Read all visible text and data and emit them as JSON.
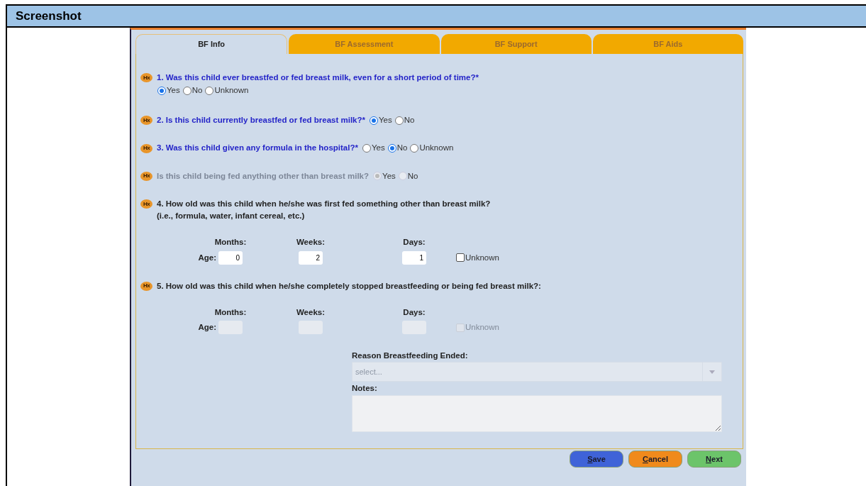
{
  "document_header": {
    "title": "Screenshot"
  },
  "tabs": [
    {
      "label": "BF Info",
      "selected": true
    },
    {
      "label": "BF Assessment",
      "selected": false
    },
    {
      "label": "BF Support",
      "selected": false
    },
    {
      "label": "BF Aids",
      "selected": false
    }
  ],
  "questions": [
    {
      "kind": "radio-below",
      "badge": "Hx",
      "text": "1. Was this child ever breastfed or fed breast milk, even for a short period of time?*",
      "required": true,
      "disabled": false,
      "options": [
        {
          "label": "Yes",
          "selected": true
        },
        {
          "label": "No",
          "selected": false
        },
        {
          "label": "Unknown",
          "selected": false
        }
      ]
    },
    {
      "kind": "radio-inline",
      "badge": "Hx",
      "text": "2. Is this child currently breastfed or fed breast milk?*",
      "required": true,
      "disabled": false,
      "options": [
        {
          "label": "Yes",
          "selected": true
        },
        {
          "label": "No",
          "selected": false
        }
      ]
    },
    {
      "kind": "radio-inline",
      "badge": "Hx",
      "text": "3. Was this child given any formula in the hospital?*",
      "required": true,
      "disabled": false,
      "options": [
        {
          "label": "Yes",
          "selected": false
        },
        {
          "label": "No",
          "selected": true
        },
        {
          "label": "Unknown",
          "selected": false
        }
      ]
    },
    {
      "kind": "radio-inline",
      "badge": "Hx",
      "text": "Is this child being fed anything other than breast milk?",
      "required": false,
      "disabled": true,
      "options": [
        {
          "label": "Yes",
          "selected": true
        },
        {
          "label": "No",
          "selected": false
        }
      ]
    },
    {
      "kind": "age",
      "badge": "Hx",
      "text": "4. How old was this child when he/she was first fed something other than breast milk?",
      "note": "(i.e., formula, water, infant cereal, etc.)",
      "required": false,
      "disabled": false,
      "age_label": "Age:",
      "fields_disabled": false,
      "columns": [
        {
          "label": "Months:",
          "value": "0"
        },
        {
          "label": "Weeks:",
          "value": "2"
        },
        {
          "label": "Days:",
          "value": "1"
        }
      ],
      "unknown": {
        "label": "Unknown",
        "checked": false
      }
    },
    {
      "kind": "age",
      "badge": "Hx",
      "text": "5. How old was this child when he/she completely stopped breastfeeding or being fed breast milk?:",
      "required": false,
      "disabled": false,
      "age_label": "Age:",
      "fields_disabled": true,
      "columns": [
        {
          "label": "Months:"
        },
        {
          "label": "Weeks:"
        },
        {
          "label": "Days:"
        }
      ],
      "unknown": {
        "label": "Unknown",
        "checked": false
      }
    }
  ],
  "reason": {
    "label": "Reason Breastfeeding Ended:",
    "placeholder": "select...",
    "disabled": true
  },
  "notes": {
    "label": "Notes:"
  },
  "buttons": [
    {
      "label": "Save",
      "mnemonic_underlined": true,
      "color": "#3f63d8"
    },
    {
      "label": "Cancel",
      "mnemonic_underlined": true,
      "color": "#f08a1c"
    },
    {
      "label": "Next",
      "mnemonic_underlined": true,
      "color": "#6cc46a"
    }
  ]
}
